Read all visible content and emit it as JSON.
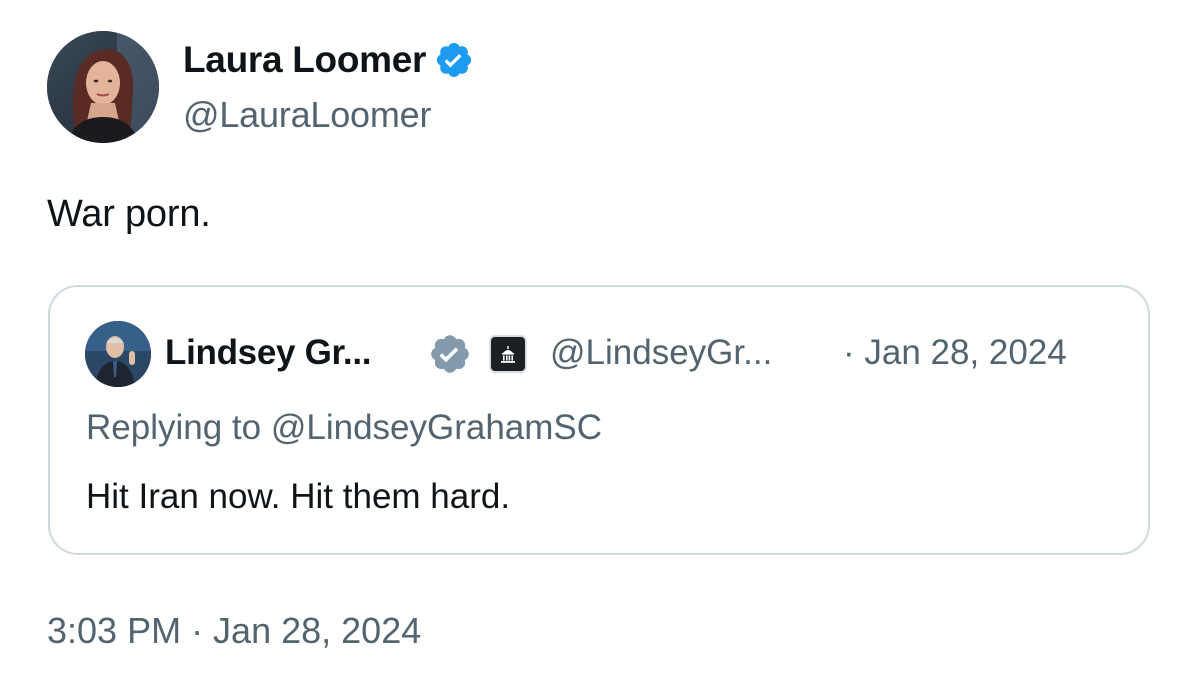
{
  "author": {
    "display_name": "Laura Loomer",
    "handle": "@LauraLoomer",
    "verified_icon": "verified-badge-icon",
    "verified_color": "#1d9bf0"
  },
  "tweet": {
    "text": "War porn.",
    "timestamp": "3:03 PM · Jan 28, 2024"
  },
  "quote": {
    "display_name": "Lindsey Gr...",
    "handle": "@LindseyGr...",
    "date": "· Jan 28, 2024",
    "replying_to": "Replying to @LindseyGrahamSC",
    "text": "Hit Iran now. Hit them hard.",
    "verified_icon": "government-verified-badge-icon",
    "verified_color": "#829aab",
    "affiliate_icon": "capitol-building-icon"
  },
  "colors": {
    "text_primary": "#0f1419",
    "text_secondary": "#536471",
    "border": "#cfd9de"
  }
}
